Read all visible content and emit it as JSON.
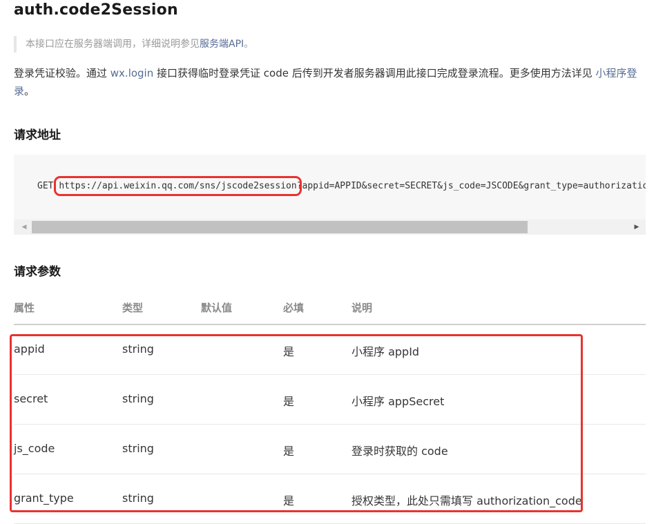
{
  "title": "auth.code2Session",
  "note": {
    "text": "本接口应在服务器端调用，详细说明参见",
    "link": "服务端API",
    "suffix": "。"
  },
  "description": {
    "part1": "登录凭证校验。通过 ",
    "link1": "wx.login",
    "part2": " 接口获得临时登录凭证 code 后传到开发者服务器调用此接口完成登录流程。更多使用方法详见 ",
    "link2": "小程序登录",
    "part3": "。"
  },
  "request_url": {
    "heading": "请求地址",
    "method": "GET",
    "url": "https://api.weixin.qq.com/sns/jscode2session",
    "query": "?appid=APPID&secret=SECRET&js_code=JSCODE&grant_type=authorization_code"
  },
  "scroll": {
    "left_arrow": "◀",
    "right_arrow": "▶"
  },
  "params": {
    "heading": "请求参数",
    "columns": [
      "属性",
      "类型",
      "默认值",
      "必填",
      "说明"
    ],
    "rows": [
      {
        "name": "appid",
        "type": "string",
        "default": "",
        "required": "是",
        "desc": "小程序 appId"
      },
      {
        "name": "secret",
        "type": "string",
        "default": "",
        "required": "是",
        "desc": "小程序 appSecret"
      },
      {
        "name": "js_code",
        "type": "string",
        "default": "",
        "required": "是",
        "desc": "登录时获取的 code"
      },
      {
        "name": "grant_type",
        "type": "string",
        "default": "",
        "required": "是",
        "desc": "授权类型，此处只需填写 authorization_code"
      }
    ]
  },
  "colors": {
    "link": "#576b95",
    "highlight": "#e8322e"
  }
}
